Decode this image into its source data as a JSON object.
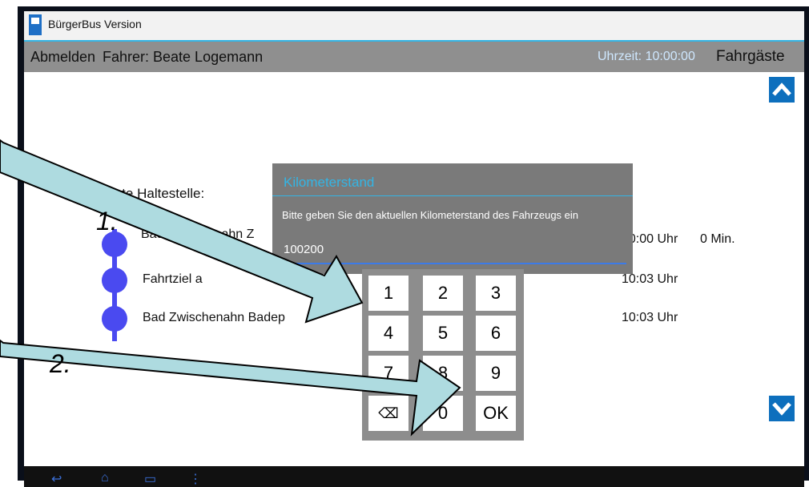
{
  "window": {
    "title": "BürgerBus Version"
  },
  "header": {
    "logout_label": "Abmelden",
    "driver": "Fahrer: Beate Logemann",
    "time": "Uhrzeit: 10:00:00",
    "passengers_label": "Fahrgäste"
  },
  "main": {
    "next_stop_label": "Nächste Haltestelle:",
    "stops": [
      {
        "name": "Bad Zwischenahn Z",
        "time": "10:00 Uhr",
        "delay": "0 Min."
      },
      {
        "name": "Fahrtziel a",
        "time": "10:03 Uhr"
      },
      {
        "name": "Bad Zwischenahn Badep",
        "time": "10:03 Uhr"
      }
    ]
  },
  "dialog": {
    "title": "Kilometerstand",
    "message": "Bitte geben Sie den aktuellen Kilometerstand des Fahrzeugs ein",
    "value": "100200"
  },
  "keypad": {
    "keys": [
      "1",
      "2",
      "3",
      "4",
      "5",
      "6",
      "7",
      "8",
      "9",
      "⌫",
      "0",
      "OK"
    ]
  },
  "annotations": {
    "step1": "1.",
    "step2": "2."
  },
  "colors": {
    "accent": "#33b5e5",
    "route": "#4a4af0",
    "scroll": "#0d6fbd"
  }
}
